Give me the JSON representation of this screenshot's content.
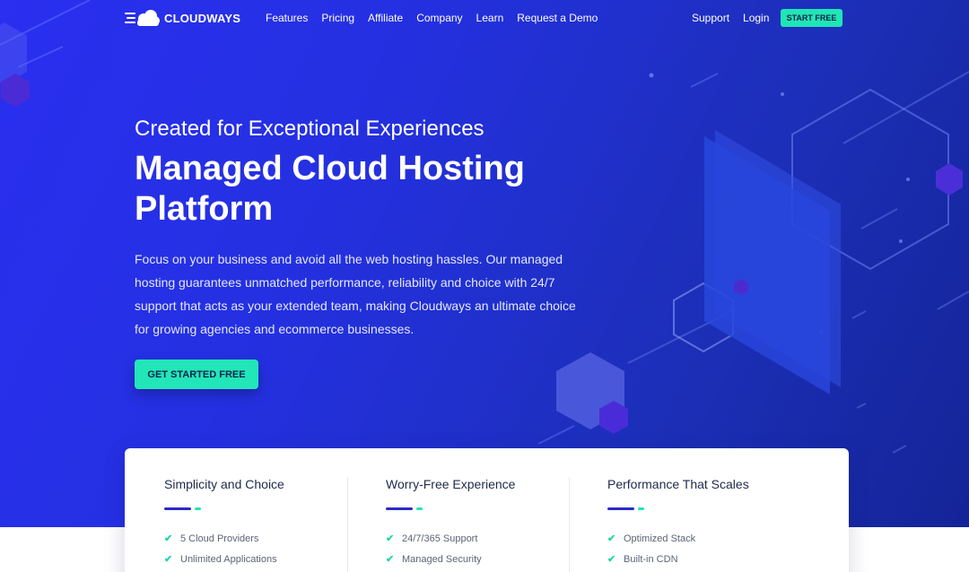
{
  "brand": {
    "name": "CLOUDWAYS"
  },
  "nav": {
    "links": [
      "Features",
      "Pricing",
      "Affiliate",
      "Company",
      "Learn",
      "Request a Demo"
    ],
    "right_links": [
      "Support",
      "Login"
    ],
    "start_free": "START FREE"
  },
  "hero": {
    "subtitle": "Created for Exceptional Experiences",
    "title": "Managed Cloud Hosting Platform",
    "description": "Focus on your business and avoid all the web hosting hassles. Our managed hosting guarantees unmatched performance, reliability and choice with 24/7 support that acts as your extended team, making Cloudways an ultimate choice for growing agencies and ecommerce businesses.",
    "cta": "GET STARTED FREE"
  },
  "features": [
    {
      "title": "Simplicity and Choice",
      "items": [
        "5 Cloud Providers",
        "Unlimited Applications"
      ]
    },
    {
      "title": "Worry-Free Experience",
      "items": [
        "24/7/365 Support",
        "Managed Security"
      ]
    },
    {
      "title": "Performance That Scales",
      "items": [
        "Optimized Stack",
        "Built-in CDN"
      ]
    }
  ],
  "colors": {
    "accent": "#20e6b6",
    "hero_blue": "#2430e0",
    "dark_text": "#1e2a4a"
  }
}
